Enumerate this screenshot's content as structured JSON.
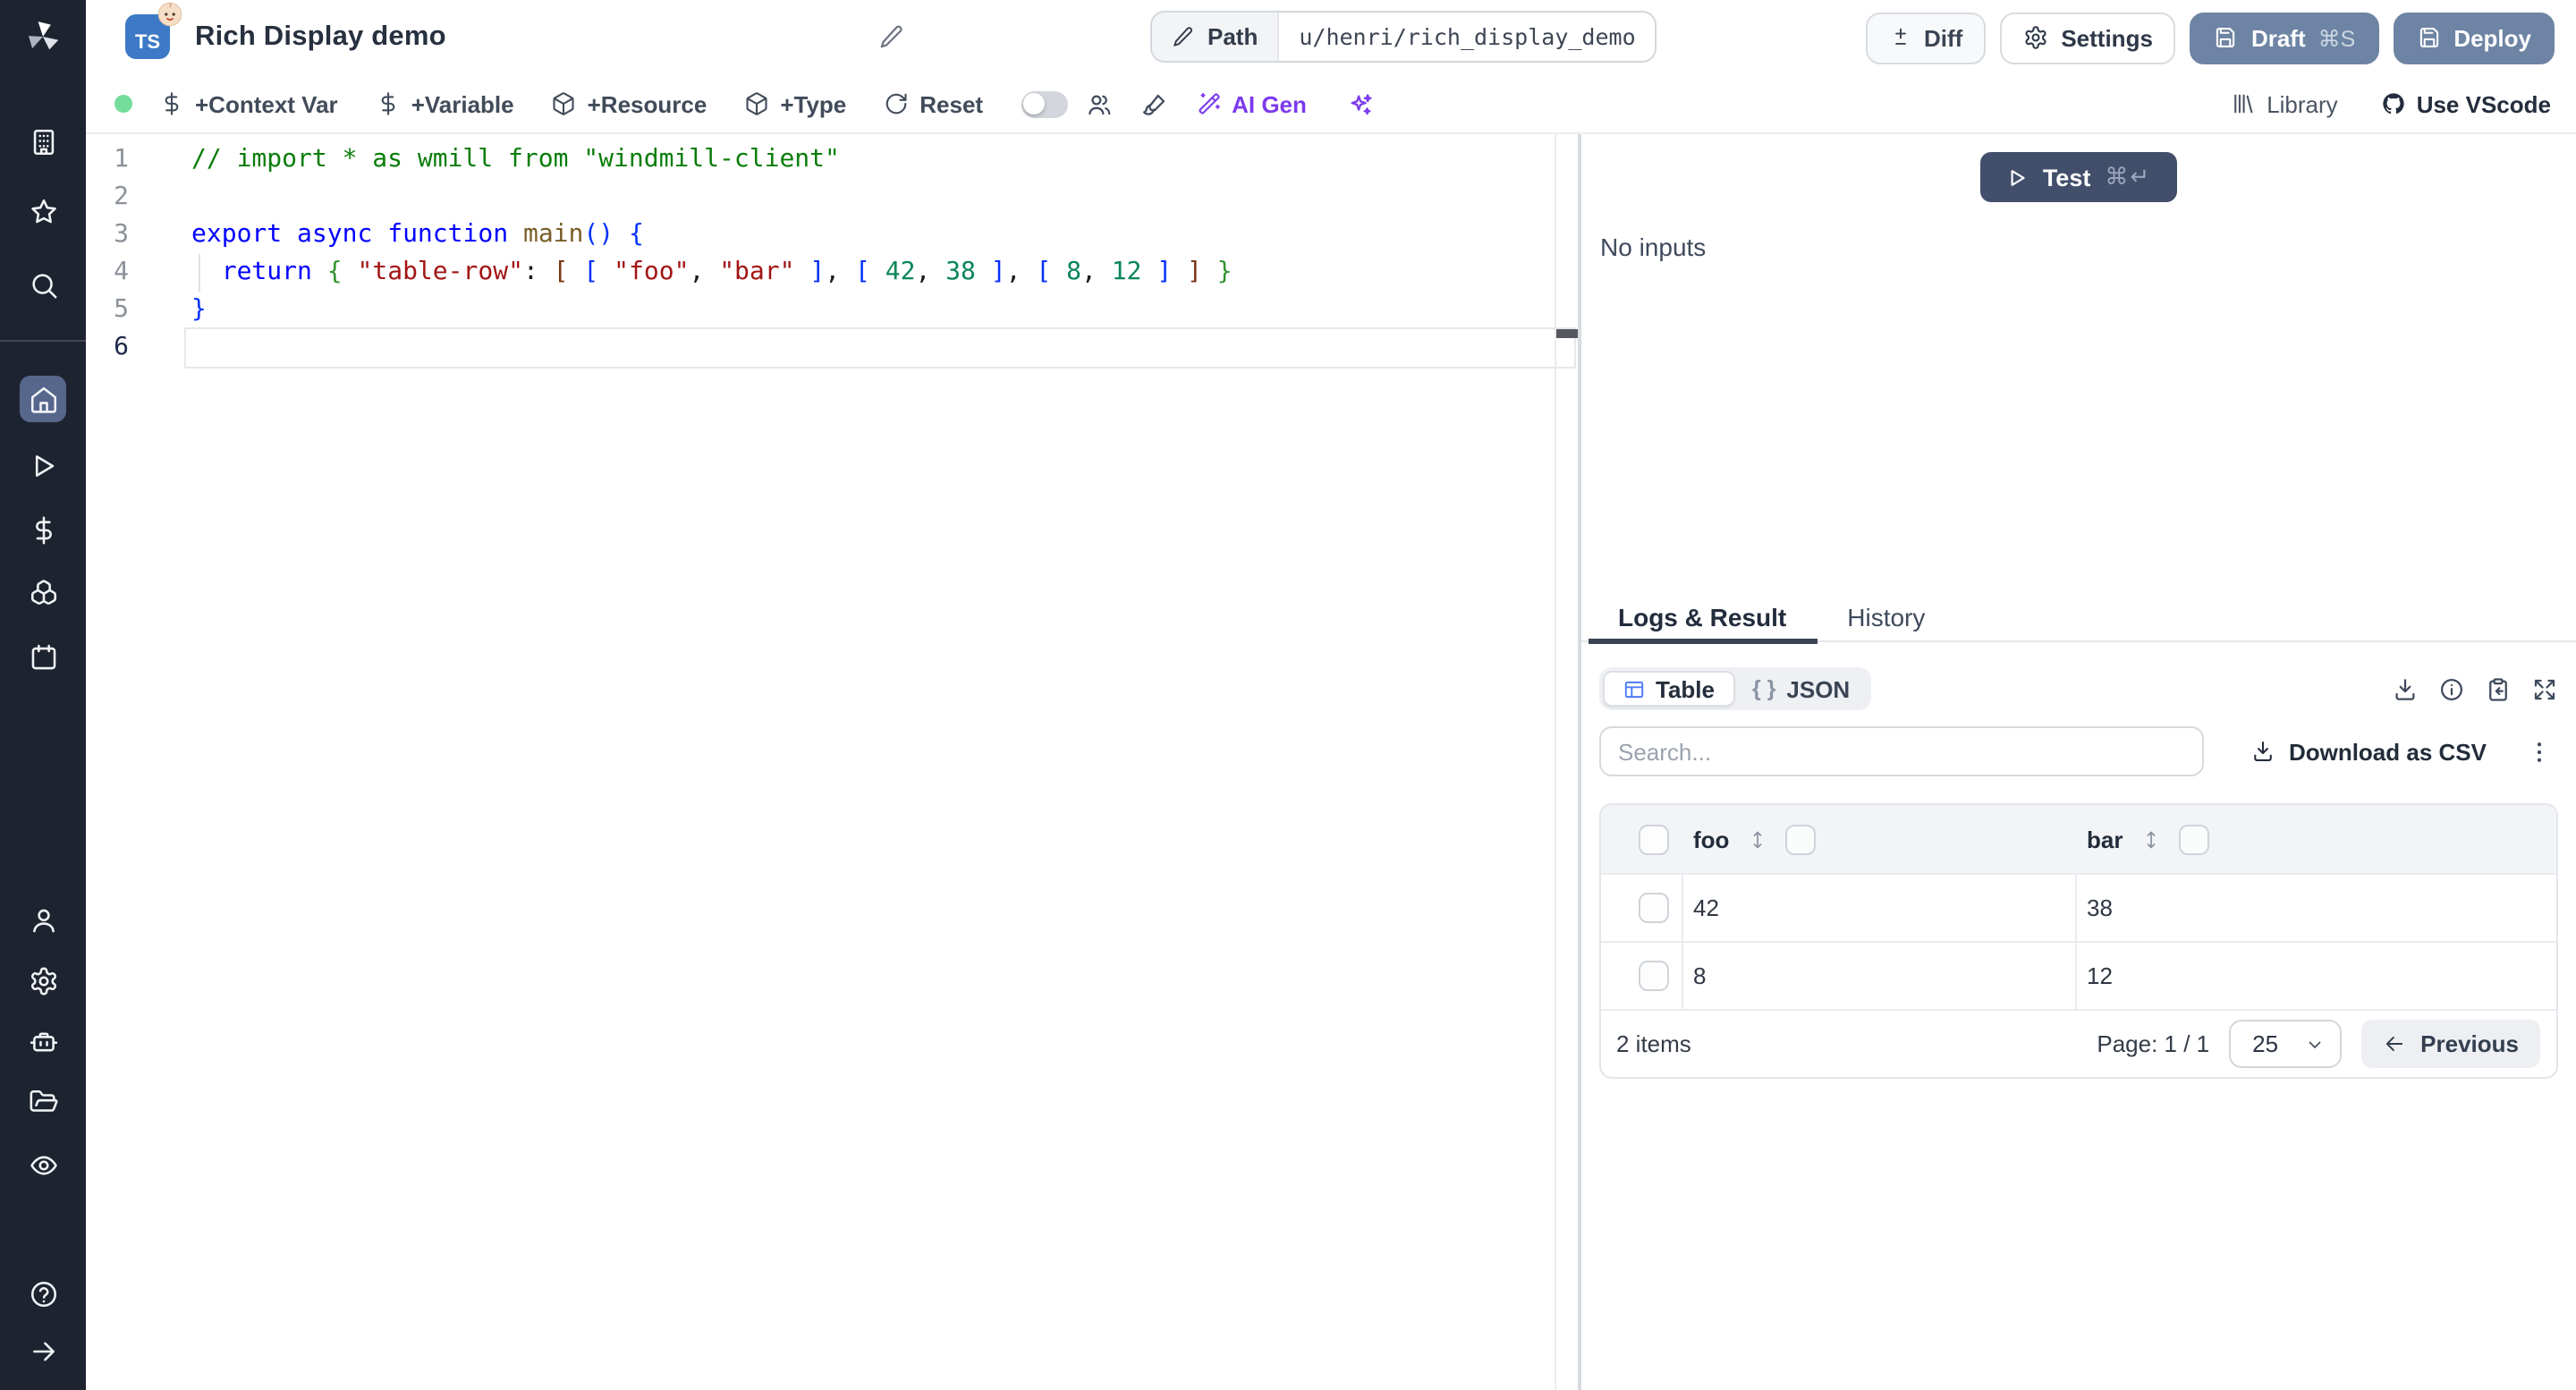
{
  "colors": {
    "sidebar_bg": "#1e242f",
    "sidebar_active": "#57678c",
    "slate_button": "#6e84a4",
    "test_button": "#424f6b",
    "ai_purple": "#7c3aed",
    "green_status_dot": "#74dd9b",
    "table_icon_blue": "#4f7bf7",
    "ts_badge_blue": "#3d79c6",
    "active_tab_underline": "#3b4456"
  },
  "sidebar": {
    "items": [
      {
        "icon": "building"
      },
      {
        "icon": "star"
      },
      {
        "icon": "search"
      },
      {
        "icon": "home",
        "active": true
      },
      {
        "icon": "play"
      },
      {
        "icon": "dollar"
      },
      {
        "icon": "boxes"
      },
      {
        "icon": "calendar"
      },
      {
        "icon": "user"
      },
      {
        "icon": "settings"
      },
      {
        "icon": "robot"
      },
      {
        "icon": "folder"
      },
      {
        "icon": "eye"
      },
      {
        "icon": "help"
      },
      {
        "icon": "arrow-right"
      }
    ]
  },
  "header": {
    "badge": "TS",
    "title": "Rich Display demo",
    "path_label": "Path",
    "path_value": "u/henri/rich_display_demo",
    "diff": "Diff",
    "settings": "Settings",
    "draft": "Draft",
    "draft_shortcut": "⌘S",
    "deploy": "Deploy"
  },
  "toolbar": {
    "add_context_var": "+Context Var",
    "add_variable": "+Variable",
    "add_resource": "+Resource",
    "add_type": "+Type",
    "reset": "Reset",
    "ai_gen": "AI Gen",
    "library": "Library",
    "use_vscode": "Use VScode"
  },
  "editor": {
    "language": "typescript",
    "active_line": 6,
    "lines": [
      {
        "n": 1,
        "tokens": [
          {
            "t": "// import * as wmill from \"windmill-client\"",
            "c": "comment"
          }
        ]
      },
      {
        "n": 2,
        "tokens": []
      },
      {
        "n": 3,
        "tokens": [
          {
            "t": "export",
            "c": "kw"
          },
          {
            "t": " ",
            "c": "pl"
          },
          {
            "t": "async",
            "c": "kw"
          },
          {
            "t": " ",
            "c": "pl"
          },
          {
            "t": "function",
            "c": "kw"
          },
          {
            "t": " ",
            "c": "pl"
          },
          {
            "t": "main",
            "c": "fn"
          },
          {
            "t": "(",
            "c": "b1"
          },
          {
            "t": ")",
            "c": "b1"
          },
          {
            "t": " ",
            "c": "pl"
          },
          {
            "t": "{",
            "c": "b1"
          }
        ]
      },
      {
        "n": 4,
        "tokens": [
          {
            "t": "  ",
            "c": "pl"
          },
          {
            "t": "return",
            "c": "kw"
          },
          {
            "t": " ",
            "c": "pl"
          },
          {
            "t": "{",
            "c": "b2"
          },
          {
            "t": " ",
            "c": "pl"
          },
          {
            "t": "\"table-row\"",
            "c": "str"
          },
          {
            "t": ": ",
            "c": "pl"
          },
          {
            "t": "[",
            "c": "b3"
          },
          {
            "t": " ",
            "c": "pl"
          },
          {
            "t": "[",
            "c": "b1"
          },
          {
            "t": " ",
            "c": "pl"
          },
          {
            "t": "\"foo\"",
            "c": "str"
          },
          {
            "t": ", ",
            "c": "pl"
          },
          {
            "t": "\"bar\"",
            "c": "str"
          },
          {
            "t": " ",
            "c": "pl"
          },
          {
            "t": "]",
            "c": "b1"
          },
          {
            "t": ", ",
            "c": "pl"
          },
          {
            "t": "[",
            "c": "b1"
          },
          {
            "t": " ",
            "c": "pl"
          },
          {
            "t": "42",
            "c": "num"
          },
          {
            "t": ", ",
            "c": "pl"
          },
          {
            "t": "38",
            "c": "num"
          },
          {
            "t": " ",
            "c": "pl"
          },
          {
            "t": "]",
            "c": "b1"
          },
          {
            "t": ", ",
            "c": "pl"
          },
          {
            "t": "[",
            "c": "b1"
          },
          {
            "t": " ",
            "c": "pl"
          },
          {
            "t": "8",
            "c": "num"
          },
          {
            "t": ", ",
            "c": "pl"
          },
          {
            "t": "12",
            "c": "num"
          },
          {
            "t": " ",
            "c": "pl"
          },
          {
            "t": "]",
            "c": "b1"
          },
          {
            "t": " ",
            "c": "pl"
          },
          {
            "t": "]",
            "c": "b3"
          },
          {
            "t": " ",
            "c": "pl"
          },
          {
            "t": "}",
            "c": "b2"
          }
        ]
      },
      {
        "n": 5,
        "tokens": [
          {
            "t": "}",
            "c": "b1"
          }
        ]
      },
      {
        "n": 6,
        "tokens": []
      }
    ]
  },
  "panel": {
    "test_label": "Test",
    "test_shortcut": "⌘↵",
    "no_inputs": "No inputs",
    "tabs": [
      {
        "label": "Logs & Result",
        "active": true
      },
      {
        "label": "History",
        "active": false
      }
    ],
    "view_modes": [
      {
        "label": "Table",
        "active": true
      },
      {
        "label": "JSON",
        "braces": "{ }",
        "active": false
      }
    ],
    "search_placeholder": "Search...",
    "download_csv": "Download as CSV",
    "table": {
      "columns": [
        "foo",
        "bar"
      ],
      "rows": [
        [
          "42",
          "38"
        ],
        [
          "8",
          "12"
        ]
      ],
      "items_label": "2 items",
      "page_label": "Page: 1 / 1",
      "page_size": "25",
      "previous": "Previous"
    }
  }
}
